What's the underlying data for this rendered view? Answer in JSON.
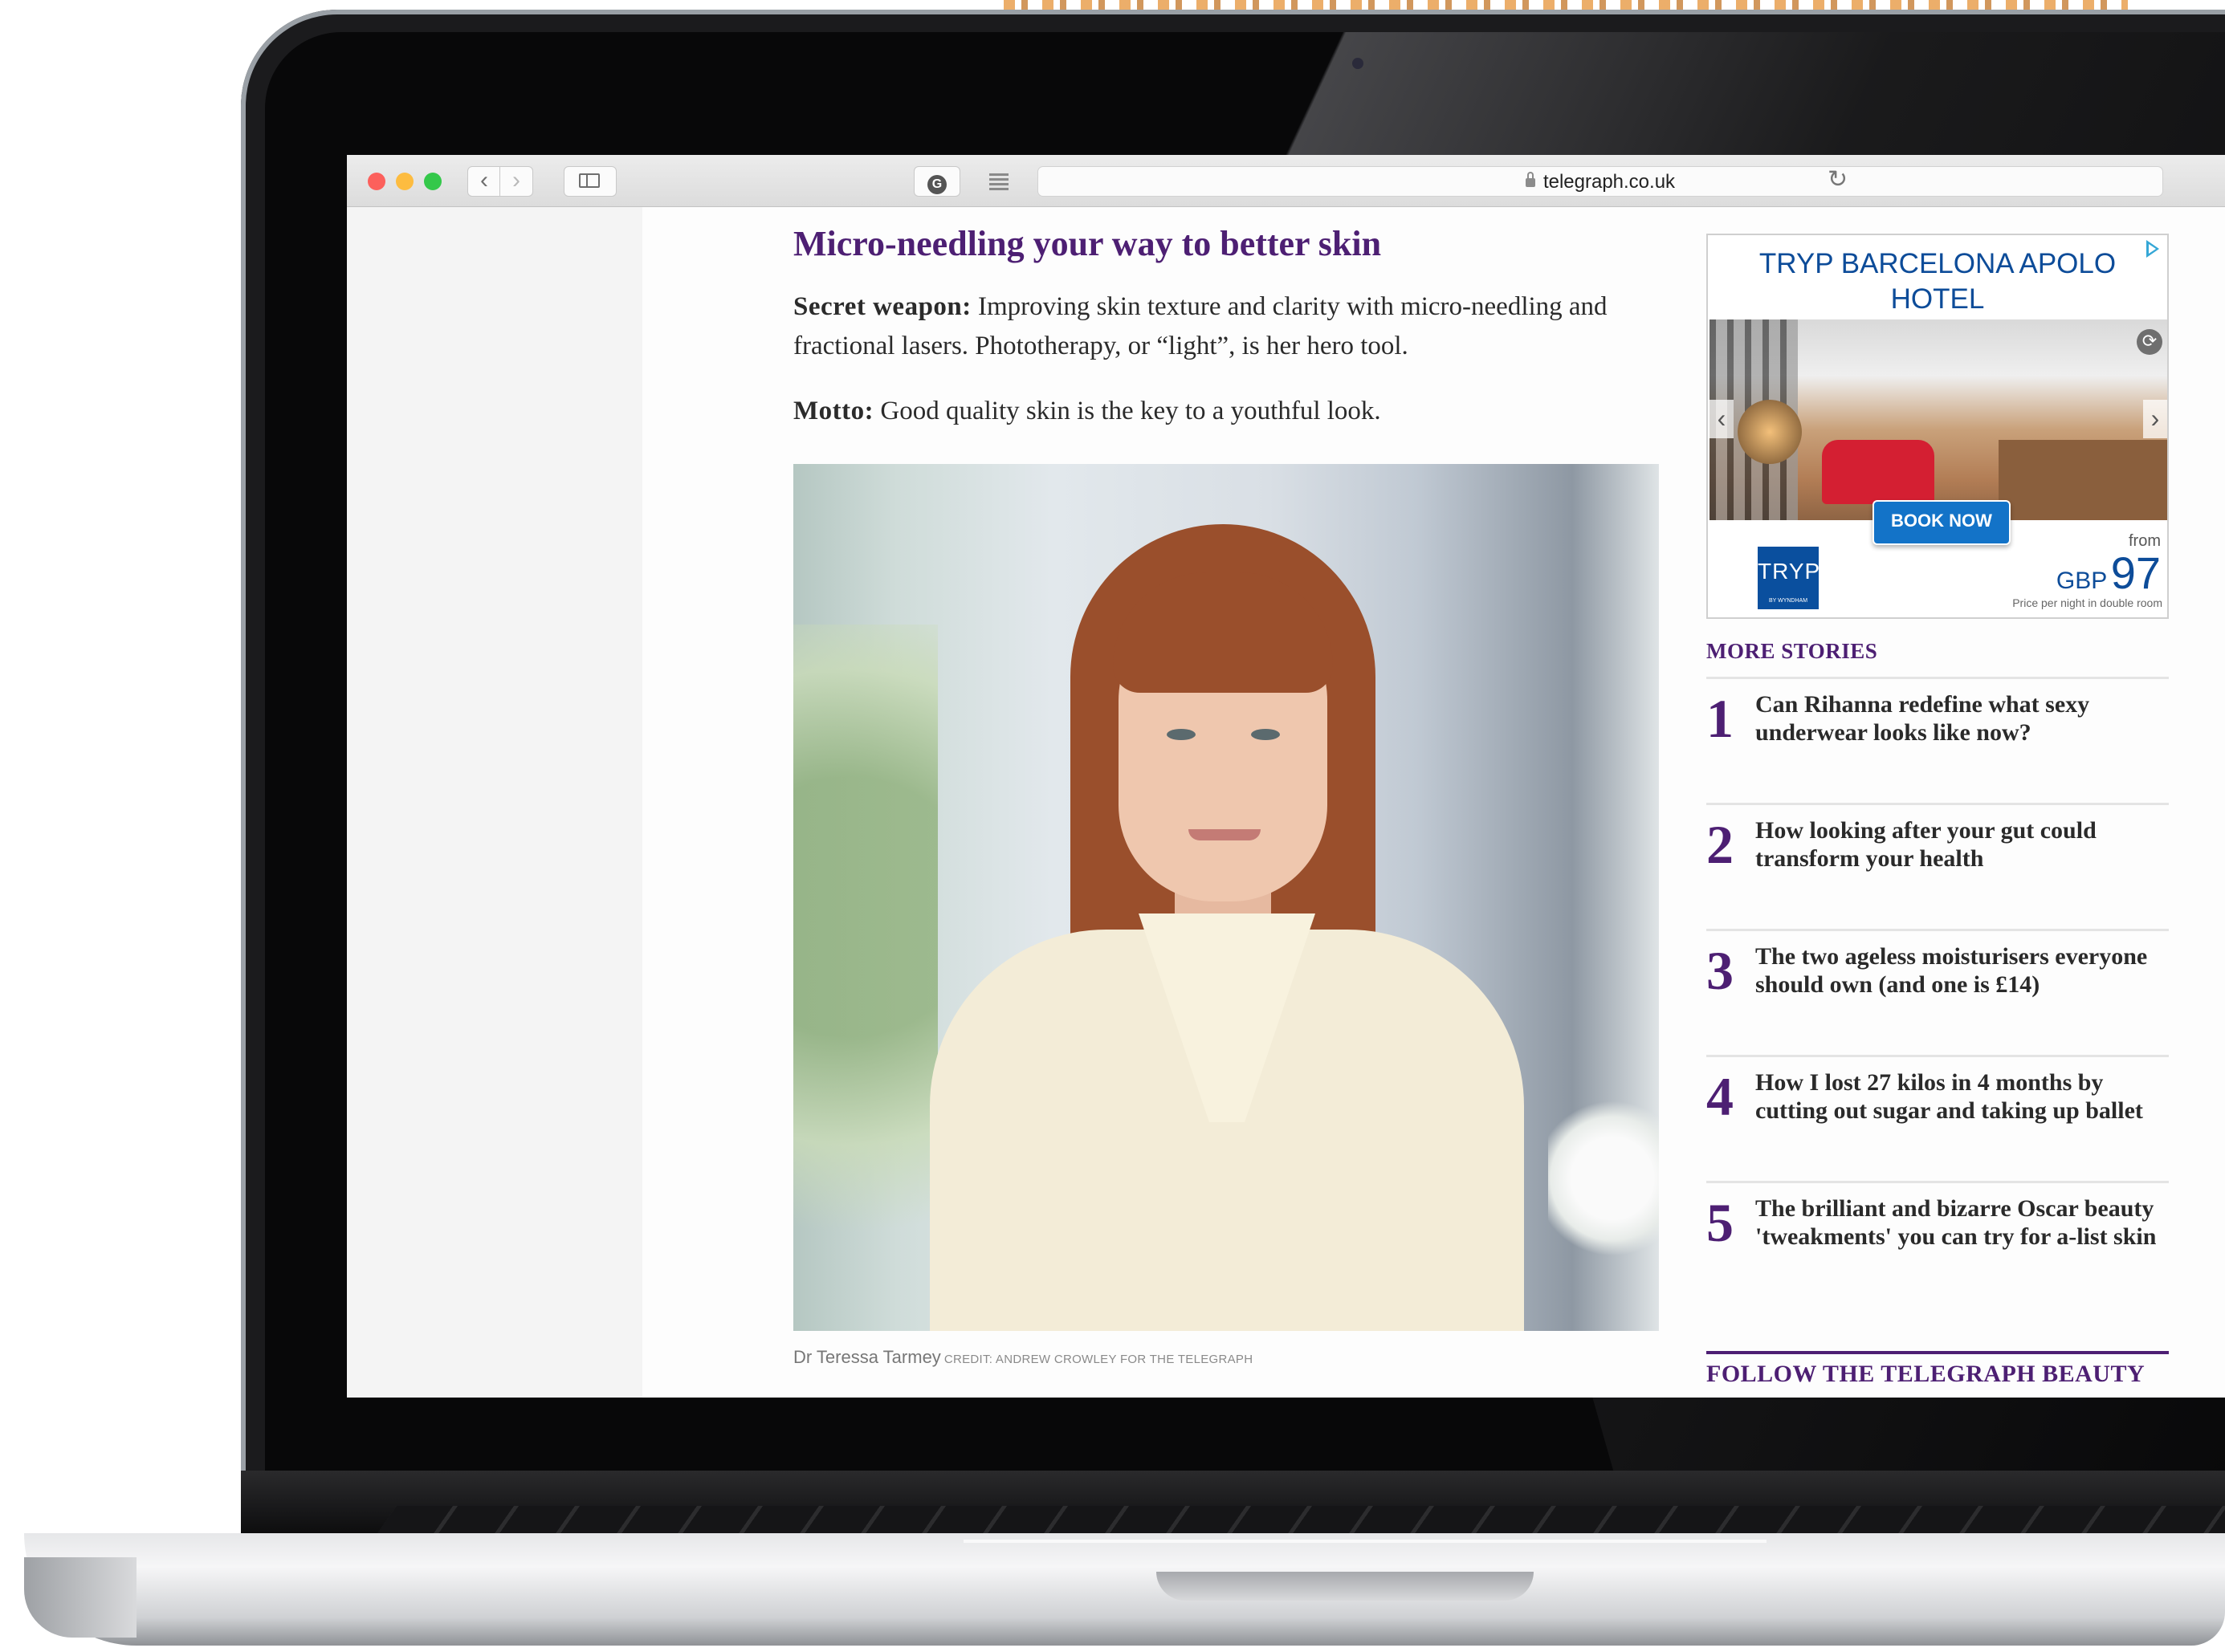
{
  "browser": {
    "url": "telegraph.co.uk",
    "back_label": "‹",
    "forward_label": "›",
    "grammarly_label": "G",
    "reload_label": "↻"
  },
  "article": {
    "headline": "Micro-needling your way to better skin",
    "secret_weapon_label": "Secret weapon:",
    "secret_weapon_text": " Improving skin texture and clarity with micro-needling and fractional lasers. Phototherapy, or “light”, is her hero tool.",
    "motto_label": "Motto:",
    "motto_text": " Good quality skin is the key to a youthful look.",
    "caption": "Dr Teressa Tarmey",
    "credit": "CREDIT: ANDREW CROWLEY FOR THE TELEGRAPH"
  },
  "ad": {
    "title_line1": "TRYP BARCELONA APOLO",
    "title_line2": "HOTEL",
    "cta": "BOOK NOW",
    "logo_text": "TRYP",
    "logo_sub": "BY WYNDHAM",
    "from_label": "from",
    "currency": "GBP",
    "price": "97",
    "price_note": "Price per night in double room",
    "arrow_left": "‹",
    "arrow_right": "›",
    "refresh_symbol": "⟳"
  },
  "more_stories": {
    "heading": "MORE STORIES",
    "items": [
      {
        "num": "1",
        "title": "Can Rihanna redefine what sexy underwear looks like now?"
      },
      {
        "num": "2",
        "title": "How looking after your gut could transform your health"
      },
      {
        "num": "3",
        "title": "The two ageless moisturisers everyone should own (and one is £14)"
      },
      {
        "num": "4",
        "title": "How I lost 27 kilos in 4 months by cutting out sugar and taking up ballet"
      },
      {
        "num": "5",
        "title": "The brilliant and bizarre Oscar beauty 'tweakments' you can try for a-list skin"
      }
    ]
  },
  "follow": {
    "heading": "FOLLOW THE TELEGRAPH BEAUTY"
  },
  "colors": {
    "telegraph_purple": "#4d1f73",
    "ad_blue": "#0d4c99",
    "cta_blue": "#1373c8"
  }
}
